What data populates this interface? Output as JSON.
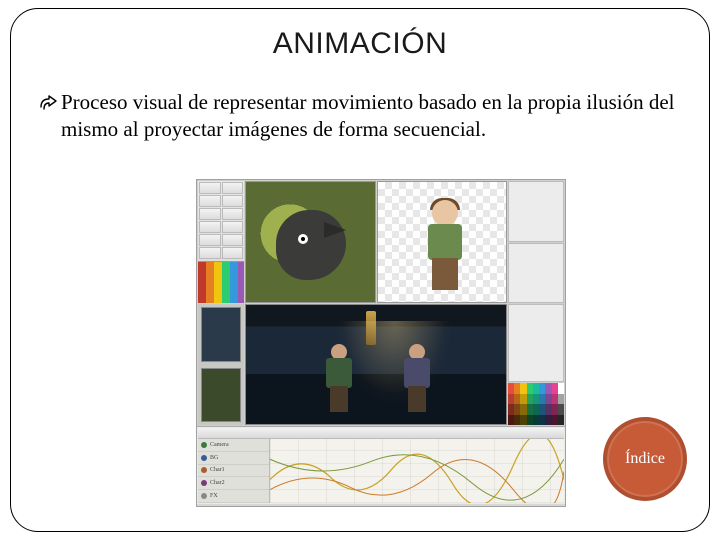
{
  "slide": {
    "title": "ANIMACIÓN",
    "bullet_glyph": "curved-arrow",
    "text": "Proceso visual de representar movimiento basado en la propia ilusión del mismo al proyectar imágenes de forma secuencial."
  },
  "badge": {
    "label": "Índice",
    "color": "#c75a37",
    "border": "#b04f2f"
  },
  "screenshot": {
    "description": "Animation software multi-pane editor",
    "panes": {
      "toolbox": "drawing tools + color swatches",
      "canvas_left": "green background with cartoon wolf head",
      "canvas_right": "checkerboard transparency with cartoon boy",
      "main_scene": "dark dungeon scene with two characters under lamp light",
      "palette": "color palette grid",
      "timeline": {
        "header": "",
        "layers": [
          "Camera",
          "BG",
          "Char1",
          "Char2",
          "FX"
        ]
      }
    }
  }
}
